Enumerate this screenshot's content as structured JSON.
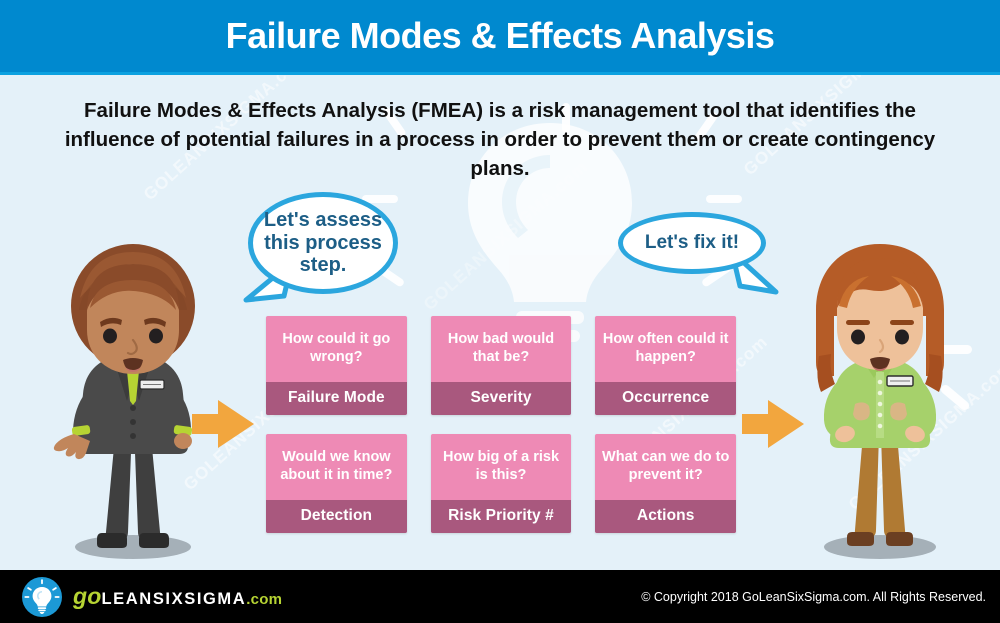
{
  "header": {
    "title": "Failure Modes & Effects Analysis",
    "bar_color": "#0089CF"
  },
  "description": {
    "text": "Failure Modes & Effects Analysis (FMEA) is a risk management tool that identifies the influence of potential failures in a process in order to prevent them or create contingency plans."
  },
  "background": {
    "color": "#E4F1F9",
    "watermark_text": "GOLEANSIXSIGMA.com",
    "bulb_icon": "lightbulb-watermark-icon"
  },
  "characters": {
    "left": {
      "name": "process-owner-man",
      "hair_color": "#8A4B2A",
      "skin_color": "#C1865B",
      "suit_color": "#4A4A4A",
      "tie_color": "#B6D433",
      "expression": "worried"
    },
    "right": {
      "name": "improvement-lead-woman",
      "hair_color": "#B55C27",
      "skin_color": "#EEC19A",
      "blouse_color": "#A6D16B",
      "pants_color": "#B07A33",
      "expression": "determined"
    }
  },
  "bubbles": {
    "left": {
      "text": "Let's assess this process step.",
      "border_color": "#2BA6DE",
      "text_color": "#1D5E86"
    },
    "right": {
      "text": "Let's fix it!",
      "border_color": "#2BA6DE",
      "text_color": "#1D5E86"
    }
  },
  "arrows": {
    "color": "#F2A63E",
    "left_label": "arrow-right-from-man",
    "right_label": "arrow-right-to-woman"
  },
  "cards": {
    "question_bg": "#EE8AB5",
    "title_bg": "#A9587E",
    "rows": [
      [
        {
          "question": "How could it go wrong?",
          "title": "Failure Mode"
        },
        {
          "question": "How bad would that be?",
          "title": "Severity"
        },
        {
          "question": "How often could it happen?",
          "title": "Occurrence"
        }
      ],
      [
        {
          "question": "Would we know about it in time?",
          "title": "Detection"
        },
        {
          "question": "How big of a risk is this?",
          "title": "Risk Priority #"
        },
        {
          "question": "What can we do to prevent it?",
          "title": "Actions"
        }
      ]
    ]
  },
  "footer": {
    "logo": {
      "go": "go",
      "leansixsigma": "LEANSIXSIGMA",
      "com": ".com",
      "mark": "lightbulb-logo-icon"
    },
    "copyright": "© Copyright 2018 GoLeanSixSigma.com. All Rights Reserved."
  }
}
